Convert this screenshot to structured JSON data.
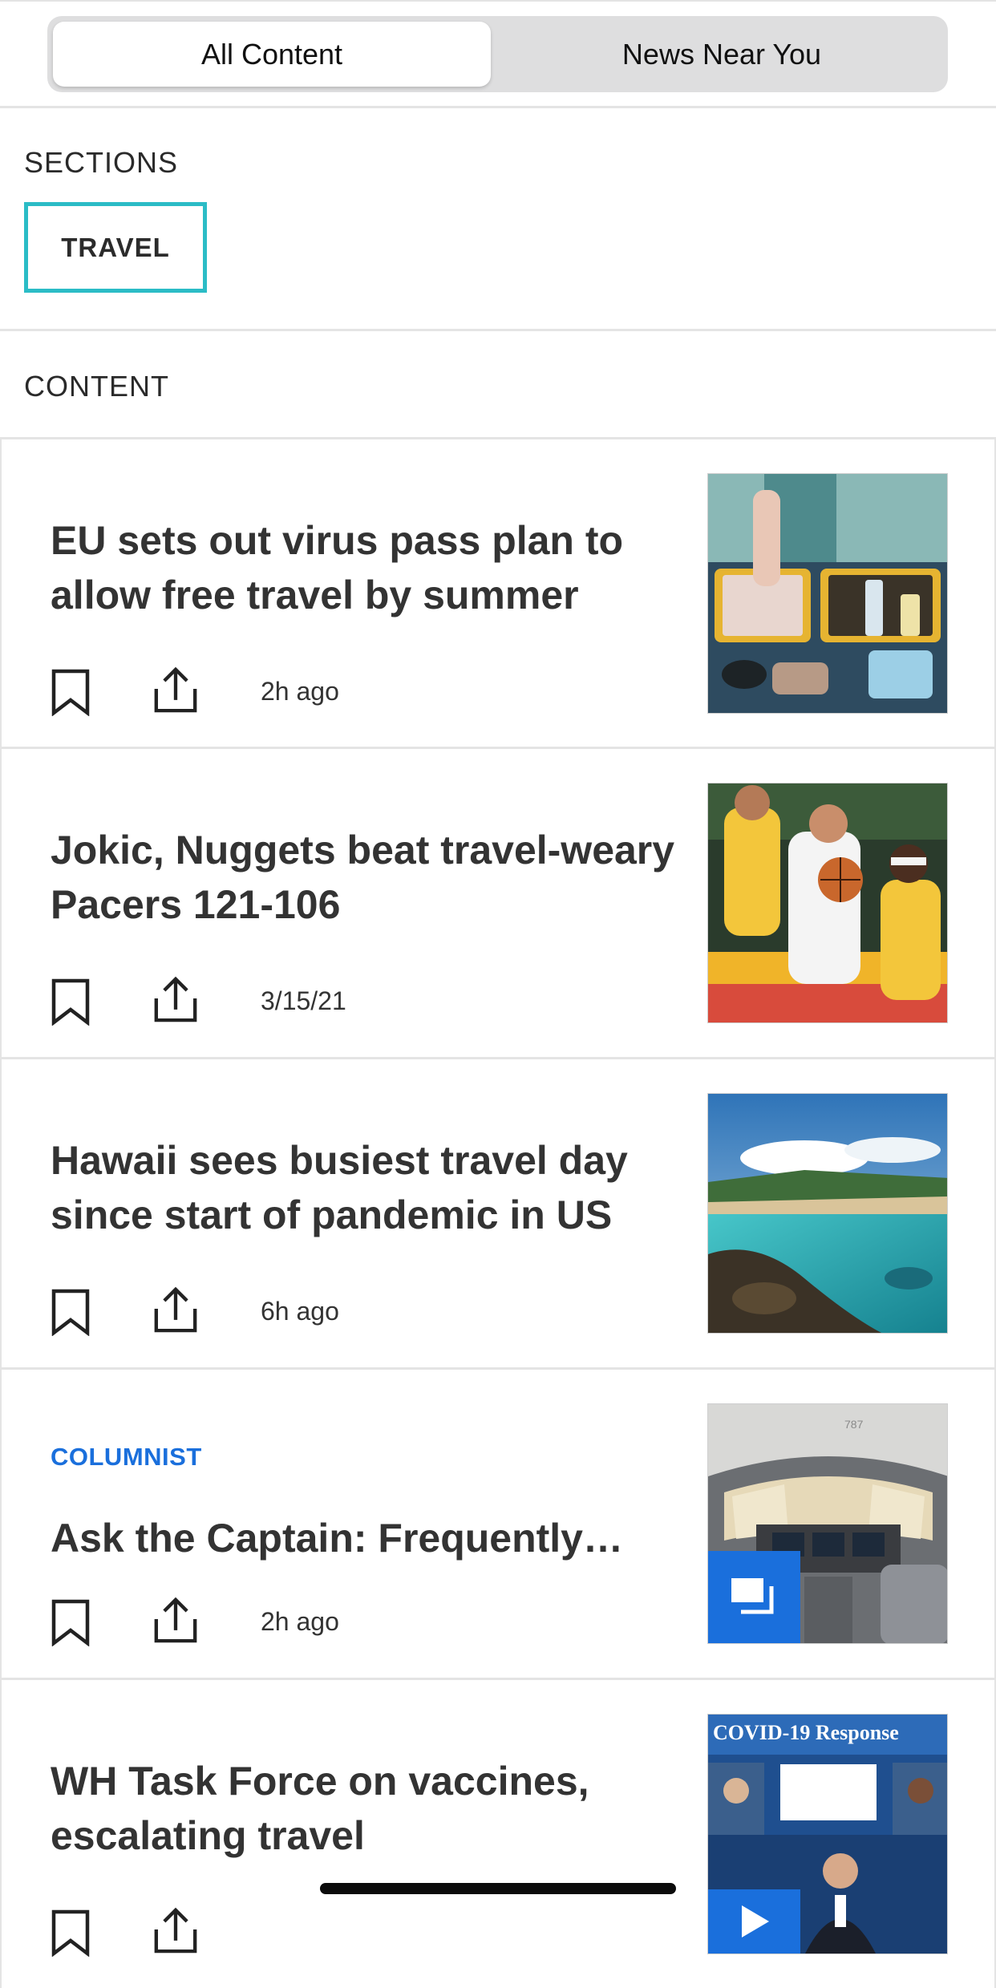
{
  "tabs": {
    "active_label": "All Content",
    "inactive_label": "News Near You"
  },
  "sections": {
    "heading": "SECTIONS",
    "chip_label": "TRAVEL",
    "chip_color": "#2bbcc6"
  },
  "content": {
    "heading": "CONTENT",
    "articles": [
      {
        "headline": "EU sets out virus pass plan to allow free travel by summer",
        "timestamp": "2h ago",
        "image": "travel-packing-photo"
      },
      {
        "headline": "Jokic, Nuggets beat travel-weary Pacers 121-106",
        "timestamp": "3/15/21",
        "image": "basketball-game-photo"
      },
      {
        "headline": "Hawaii sees busiest travel day since start of pandemic in US",
        "timestamp": "6h ago",
        "image": "hawaii-beach-photo"
      },
      {
        "label": "COLUMNIST",
        "headline": "Ask the Captain: Frequently…",
        "timestamp": "2h ago",
        "image": "cockpit-photo",
        "badge": "gallery-icon",
        "image_text": "787"
      },
      {
        "headline": "WH Task Force on vaccines, escalating travel",
        "timestamp": "",
        "image": "briefing-video-still",
        "image_text": "COVID-19 Response",
        "badge": "play-icon"
      }
    ]
  },
  "colors": {
    "accent_blue": "#1a6fdc",
    "divider": "#e4e4e4"
  }
}
